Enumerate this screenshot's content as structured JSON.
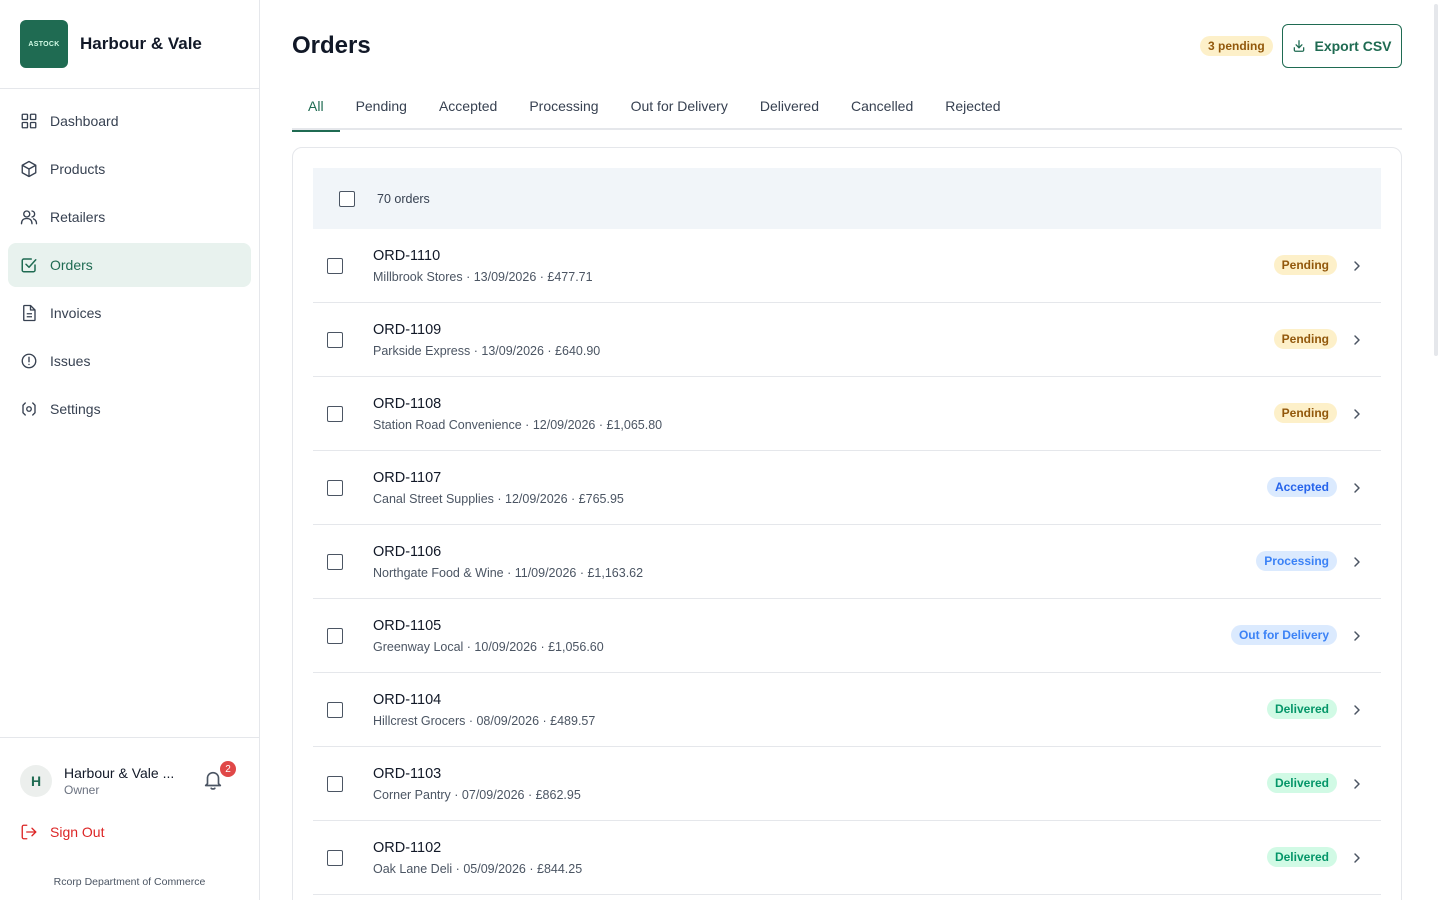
{
  "brand": {
    "name": "Harbour & Vale",
    "logo_text": "ASTOCK"
  },
  "sidebar": {
    "items": [
      {
        "label": "Dashboard",
        "icon": "grid-icon",
        "active": false
      },
      {
        "label": "Products",
        "icon": "box-icon",
        "active": false
      },
      {
        "label": "Retailers",
        "icon": "users-icon",
        "active": false
      },
      {
        "label": "Orders",
        "icon": "check-square-icon",
        "active": true
      },
      {
        "label": "Invoices",
        "icon": "file-icon",
        "active": false
      },
      {
        "label": "Issues",
        "icon": "alert-circle-icon",
        "active": false
      },
      {
        "label": "Settings",
        "icon": "gear-icon",
        "active": false
      }
    ],
    "user": {
      "initial": "H",
      "name": "Harbour & Vale ...",
      "role": "Owner",
      "notifications": "2"
    },
    "sign_out": "Sign Out",
    "copyright": "Rcorp Department of Commerce"
  },
  "header": {
    "title": "Orders",
    "pending_badge": "3 pending",
    "export_label": "Export CSV"
  },
  "tabs": [
    {
      "label": "All",
      "active": true
    },
    {
      "label": "Pending",
      "active": false
    },
    {
      "label": "Accepted",
      "active": false
    },
    {
      "label": "Processing",
      "active": false
    },
    {
      "label": "Out for Delivery",
      "active": false
    },
    {
      "label": "Delivered",
      "active": false
    },
    {
      "label": "Cancelled",
      "active": false
    },
    {
      "label": "Rejected",
      "active": false
    }
  ],
  "orders": {
    "count_label": "70 orders",
    "rows": [
      {
        "id": "ORD-1110",
        "meta": "Millbrook Stores · 13/09/2026 · £477.71",
        "status": "Pending",
        "status_class": "pending"
      },
      {
        "id": "ORD-1109",
        "meta": "Parkside Express · 13/09/2026 · £640.90",
        "status": "Pending",
        "status_class": "pending"
      },
      {
        "id": "ORD-1108",
        "meta": "Station Road Convenience · 12/09/2026 · £1,065.80",
        "status": "Pending",
        "status_class": "pending"
      },
      {
        "id": "ORD-1107",
        "meta": "Canal Street Supplies · 12/09/2026 · £765.95",
        "status": "Accepted",
        "status_class": "accepted"
      },
      {
        "id": "ORD-1106",
        "meta": "Northgate Food & Wine · 11/09/2026 · £1,163.62",
        "status": "Processing",
        "status_class": "processing"
      },
      {
        "id": "ORD-1105",
        "meta": "Greenway Local · 10/09/2026 · £1,056.60",
        "status": "Out for Delivery",
        "status_class": "delivery"
      },
      {
        "id": "ORD-1104",
        "meta": "Hillcrest Grocers · 08/09/2026 · £489.57",
        "status": "Delivered",
        "status_class": "delivered"
      },
      {
        "id": "ORD-1103",
        "meta": "Corner Pantry · 07/09/2026 · £862.95",
        "status": "Delivered",
        "status_class": "delivered"
      },
      {
        "id": "ORD-1102",
        "meta": "Oak Lane Deli · 05/09/2026 · £844.25",
        "status": "Delivered",
        "status_class": "delivered"
      }
    ]
  },
  "colors": {
    "brand": "#1f6b52",
    "active_bg": "#e8f2ee",
    "danger": "#dc2626",
    "pending_bg": "#fdf0c9",
    "info_bg": "#dbeafe",
    "success_bg": "#d1fae5"
  }
}
